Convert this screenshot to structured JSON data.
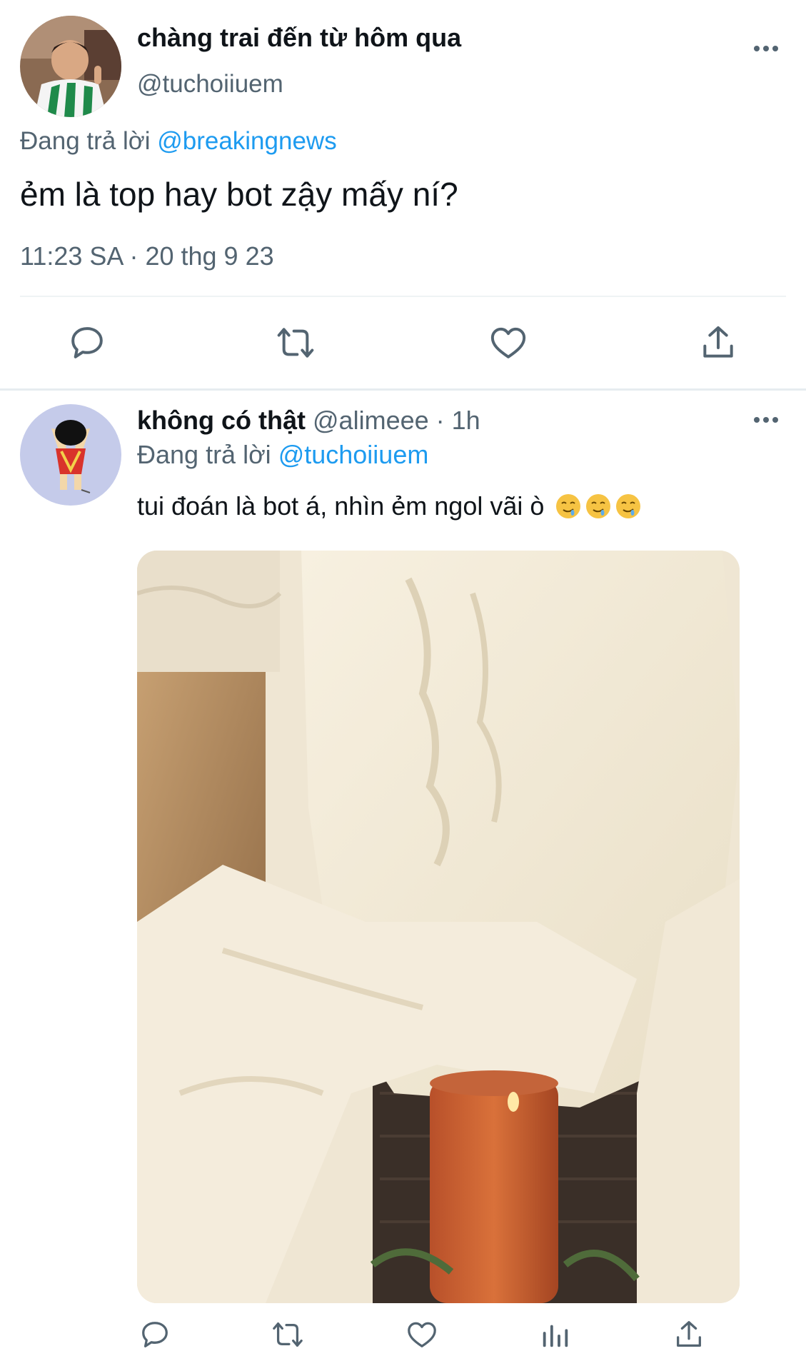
{
  "main_tweet": {
    "display_name": "chàng trai đến từ hôm qua",
    "handle": "@tuchoiiuem",
    "replying_prefix": "Đang trả lời ",
    "replying_to": "@breakingnews",
    "text": "ẻm là top hay bot zậy mấy ní?",
    "timestamp": "11:23 SA · 20 thg 9 23",
    "icons": [
      "reply-icon",
      "retweet-icon",
      "like-icon",
      "share-icon",
      "more-icon"
    ]
  },
  "reply_tweet": {
    "display_name": "không có thật",
    "handle": "@alimeee",
    "time_sep": " · ",
    "time": "1h",
    "replying_prefix": "Đang trả lời ",
    "replying_to": "@tuchoiiuem",
    "text": "tui đoán là bot á, nhìn ẻm ngol vãi ò",
    "emojis": [
      "drooling-face",
      "drooling-face",
      "drooling-face"
    ],
    "icons": [
      "reply-icon",
      "retweet-icon",
      "like-icon",
      "stats-icon",
      "share-icon",
      "more-icon"
    ]
  },
  "colors": {
    "text_primary": "#0f1419",
    "text_secondary": "#536471",
    "mention": "#1d9bf0",
    "divider": "#eff3f4"
  }
}
